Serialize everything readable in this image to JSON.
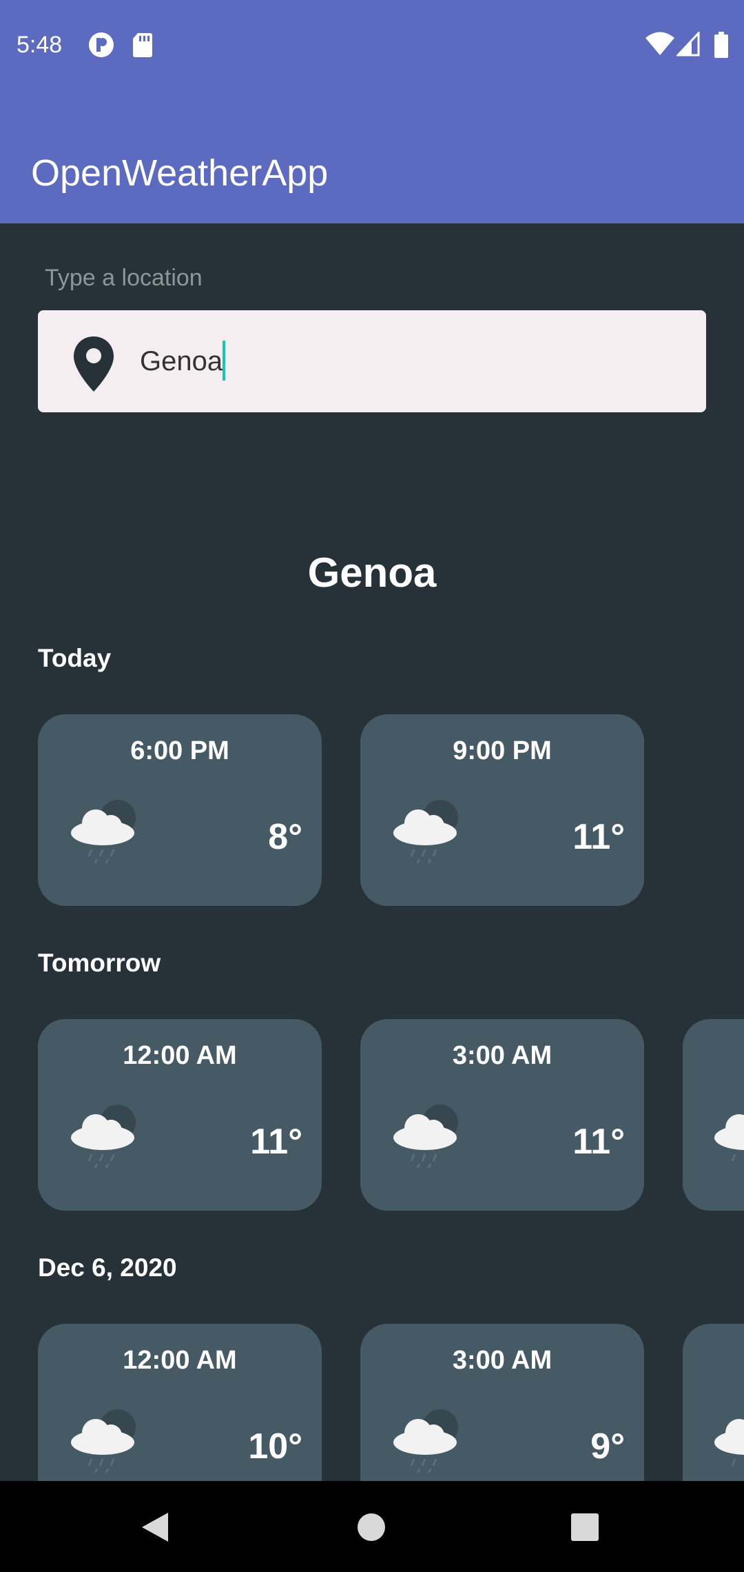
{
  "status_bar": {
    "time": "5:48",
    "icons": [
      "notification-p-icon",
      "sd-card-icon",
      "wifi-icon",
      "signal-icon",
      "battery-icon"
    ]
  },
  "app_bar": {
    "title": "OpenWeatherApp",
    "color": "#5c6bc0"
  },
  "search": {
    "label": "Type a location",
    "value": "Genoa",
    "icon": "location-pin-icon"
  },
  "city": "Genoa",
  "sections": [
    {
      "title": "Today",
      "cards": [
        {
          "time": "6:00 PM",
          "temp": "8°",
          "icon": "night-rain-cloud-icon"
        },
        {
          "time": "9:00 PM",
          "temp": "11°",
          "icon": "night-rain-cloud-icon"
        }
      ]
    },
    {
      "title": "Tomorrow",
      "cards": [
        {
          "time": "12:00 AM",
          "temp": "11°",
          "icon": "night-rain-cloud-icon"
        },
        {
          "time": "3:00 AM",
          "temp": "11°",
          "icon": "night-rain-cloud-icon"
        },
        {
          "time": "",
          "temp": "",
          "icon": "night-rain-cloud-icon"
        }
      ]
    },
    {
      "title": "Dec 6, 2020",
      "cards": [
        {
          "time": "12:00 AM",
          "temp": "10°",
          "icon": "night-rain-cloud-icon"
        },
        {
          "time": "3:00 AM",
          "temp": "9°",
          "icon": "night-rain-cloud-icon"
        },
        {
          "time": "",
          "temp": "",
          "icon": "night-rain-cloud-icon"
        }
      ]
    }
  ],
  "nav_bar": {
    "buttons": [
      "back-icon",
      "home-icon",
      "recents-icon"
    ]
  }
}
